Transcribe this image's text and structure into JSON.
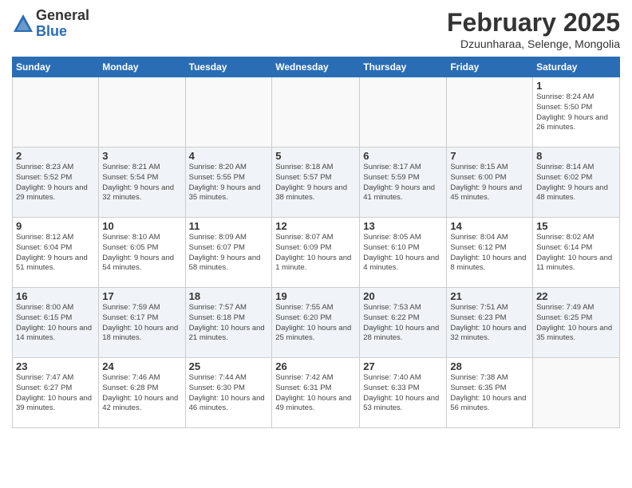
{
  "logo": {
    "general": "General",
    "blue": "Blue"
  },
  "title": "February 2025",
  "location": "Dzuunharaa, Selenge, Mongolia",
  "days_of_week": [
    "Sunday",
    "Monday",
    "Tuesday",
    "Wednesday",
    "Thursday",
    "Friday",
    "Saturday"
  ],
  "weeks": [
    [
      {
        "day": "",
        "info": ""
      },
      {
        "day": "",
        "info": ""
      },
      {
        "day": "",
        "info": ""
      },
      {
        "day": "",
        "info": ""
      },
      {
        "day": "",
        "info": ""
      },
      {
        "day": "",
        "info": ""
      },
      {
        "day": "1",
        "info": "Sunrise: 8:24 AM\nSunset: 5:50 PM\nDaylight: 9 hours and 26 minutes."
      }
    ],
    [
      {
        "day": "2",
        "info": "Sunrise: 8:23 AM\nSunset: 5:52 PM\nDaylight: 9 hours and 29 minutes."
      },
      {
        "day": "3",
        "info": "Sunrise: 8:21 AM\nSunset: 5:54 PM\nDaylight: 9 hours and 32 minutes."
      },
      {
        "day": "4",
        "info": "Sunrise: 8:20 AM\nSunset: 5:55 PM\nDaylight: 9 hours and 35 minutes."
      },
      {
        "day": "5",
        "info": "Sunrise: 8:18 AM\nSunset: 5:57 PM\nDaylight: 9 hours and 38 minutes."
      },
      {
        "day": "6",
        "info": "Sunrise: 8:17 AM\nSunset: 5:59 PM\nDaylight: 9 hours and 41 minutes."
      },
      {
        "day": "7",
        "info": "Sunrise: 8:15 AM\nSunset: 6:00 PM\nDaylight: 9 hours and 45 minutes."
      },
      {
        "day": "8",
        "info": "Sunrise: 8:14 AM\nSunset: 6:02 PM\nDaylight: 9 hours and 48 minutes."
      }
    ],
    [
      {
        "day": "9",
        "info": "Sunrise: 8:12 AM\nSunset: 6:04 PM\nDaylight: 9 hours and 51 minutes."
      },
      {
        "day": "10",
        "info": "Sunrise: 8:10 AM\nSunset: 6:05 PM\nDaylight: 9 hours and 54 minutes."
      },
      {
        "day": "11",
        "info": "Sunrise: 8:09 AM\nSunset: 6:07 PM\nDaylight: 9 hours and 58 minutes."
      },
      {
        "day": "12",
        "info": "Sunrise: 8:07 AM\nSunset: 6:09 PM\nDaylight: 10 hours and 1 minute."
      },
      {
        "day": "13",
        "info": "Sunrise: 8:05 AM\nSunset: 6:10 PM\nDaylight: 10 hours and 4 minutes."
      },
      {
        "day": "14",
        "info": "Sunrise: 8:04 AM\nSunset: 6:12 PM\nDaylight: 10 hours and 8 minutes."
      },
      {
        "day": "15",
        "info": "Sunrise: 8:02 AM\nSunset: 6:14 PM\nDaylight: 10 hours and 11 minutes."
      }
    ],
    [
      {
        "day": "16",
        "info": "Sunrise: 8:00 AM\nSunset: 6:15 PM\nDaylight: 10 hours and 14 minutes."
      },
      {
        "day": "17",
        "info": "Sunrise: 7:59 AM\nSunset: 6:17 PM\nDaylight: 10 hours and 18 minutes."
      },
      {
        "day": "18",
        "info": "Sunrise: 7:57 AM\nSunset: 6:18 PM\nDaylight: 10 hours and 21 minutes."
      },
      {
        "day": "19",
        "info": "Sunrise: 7:55 AM\nSunset: 6:20 PM\nDaylight: 10 hours and 25 minutes."
      },
      {
        "day": "20",
        "info": "Sunrise: 7:53 AM\nSunset: 6:22 PM\nDaylight: 10 hours and 28 minutes."
      },
      {
        "day": "21",
        "info": "Sunrise: 7:51 AM\nSunset: 6:23 PM\nDaylight: 10 hours and 32 minutes."
      },
      {
        "day": "22",
        "info": "Sunrise: 7:49 AM\nSunset: 6:25 PM\nDaylight: 10 hours and 35 minutes."
      }
    ],
    [
      {
        "day": "23",
        "info": "Sunrise: 7:47 AM\nSunset: 6:27 PM\nDaylight: 10 hours and 39 minutes."
      },
      {
        "day": "24",
        "info": "Sunrise: 7:46 AM\nSunset: 6:28 PM\nDaylight: 10 hours and 42 minutes."
      },
      {
        "day": "25",
        "info": "Sunrise: 7:44 AM\nSunset: 6:30 PM\nDaylight: 10 hours and 46 minutes."
      },
      {
        "day": "26",
        "info": "Sunrise: 7:42 AM\nSunset: 6:31 PM\nDaylight: 10 hours and 49 minutes."
      },
      {
        "day": "27",
        "info": "Sunrise: 7:40 AM\nSunset: 6:33 PM\nDaylight: 10 hours and 53 minutes."
      },
      {
        "day": "28",
        "info": "Sunrise: 7:38 AM\nSunset: 6:35 PM\nDaylight: 10 hours and 56 minutes."
      },
      {
        "day": "",
        "info": ""
      }
    ]
  ]
}
